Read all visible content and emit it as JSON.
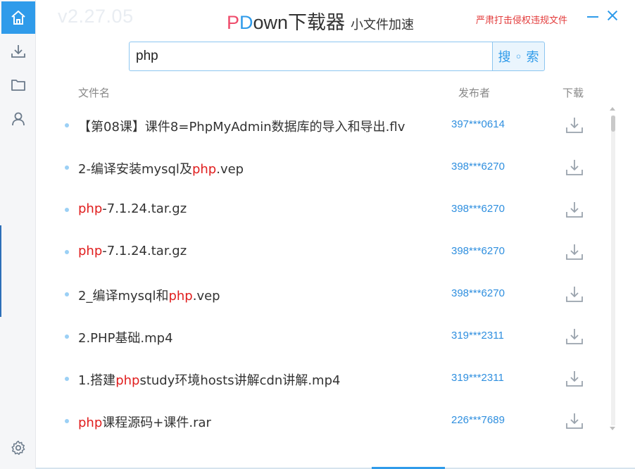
{
  "header": {
    "version": "v2.27.05",
    "brand_p": "P",
    "brand_d": "D",
    "brand_rest": "own下载器",
    "subtitle": "小文件加速",
    "report_link": "严肃打击侵权违规文件"
  },
  "sidebar": {
    "items": [
      {
        "icon": "home-icon",
        "active": true
      },
      {
        "icon": "download-icon",
        "active": false
      },
      {
        "icon": "folder-icon",
        "active": false
      },
      {
        "icon": "user-icon",
        "active": false
      },
      {
        "icon": "gear-icon",
        "active": false
      }
    ]
  },
  "search": {
    "value": "php",
    "button_label": "搜 ◦ 索"
  },
  "table": {
    "columns": {
      "name": "文件名",
      "publisher": "发布者",
      "download": "下载"
    },
    "rows": [
      {
        "parts": [
          {
            "t": "【第08课】课件8=PhpMyAdmin数据库的导入和导出.flv",
            "hl": false
          }
        ],
        "publisher": "397***0614"
      },
      {
        "parts": [
          {
            "t": "2-编译安装mysql及",
            "hl": false
          },
          {
            "t": "php",
            "hl": true
          },
          {
            "t": ".vep",
            "hl": false
          }
        ],
        "publisher": "398***6270"
      },
      {
        "parts": [
          {
            "t": "php",
            "hl": true
          },
          {
            "t": "-7.1.24.tar.gz",
            "hl": false
          }
        ],
        "publisher": "398***6270"
      },
      {
        "parts": [
          {
            "t": "php",
            "hl": true
          },
          {
            "t": "-7.1.24.tar.gz",
            "hl": false
          }
        ],
        "publisher": "398***6270"
      },
      {
        "parts": [
          {
            "t": "2_编译mysql和",
            "hl": false
          },
          {
            "t": "php",
            "hl": true
          },
          {
            "t": ".vep",
            "hl": false
          }
        ],
        "publisher": "398***6270"
      },
      {
        "parts": [
          {
            "t": "2.PHP基础.mp4",
            "hl": false
          }
        ],
        "publisher": "319***2311"
      },
      {
        "parts": [
          {
            "t": "1.搭建",
            "hl": false
          },
          {
            "t": "php",
            "hl": true
          },
          {
            "t": "study环境hosts讲解cdn讲解.mp4",
            "hl": false
          }
        ],
        "publisher": "319***2311"
      },
      {
        "parts": [
          {
            "t": "php",
            "hl": true
          },
          {
            "t": "课程源码+课件.rar",
            "hl": false
          }
        ],
        "publisher": "226***7689"
      }
    ]
  },
  "colors": {
    "accent": "#2f9bea",
    "highlight": "#e01e1e",
    "brand_pink": "#ef4d6c"
  }
}
